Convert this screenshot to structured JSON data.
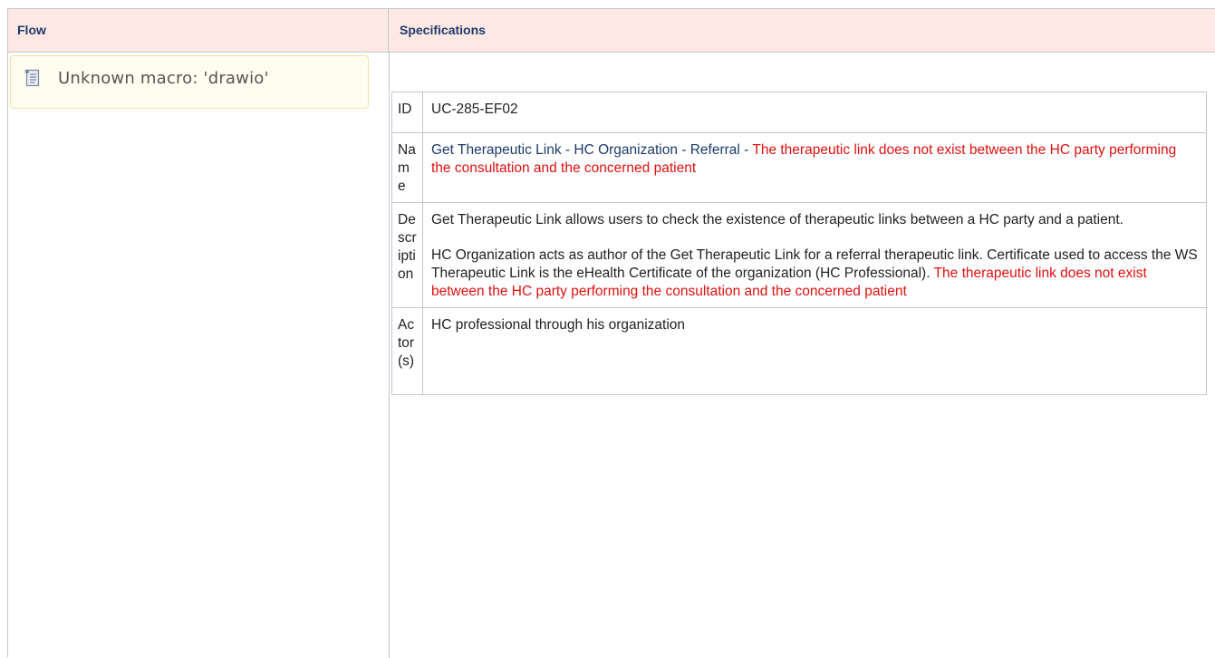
{
  "headers": {
    "flow": "Flow",
    "specifications": "Specifications"
  },
  "macro": {
    "icon": "document-icon",
    "text": "Unknown macro: 'drawio'"
  },
  "spec_rows": {
    "id": {
      "label": "ID",
      "value": "UC-285-EF02"
    },
    "name": {
      "label": "Name",
      "value_main": "Get Therapeutic Link -  HC Organization - Referral - ",
      "value_exception": "The therapeutic link does not exist between the HC party performing the consultation and the concerned patient"
    },
    "description": {
      "label": "Description",
      "paragraph1": "Get Therapeutic Link allows users to check the existence of therapeutic links between a HC party and a patient.",
      "paragraph2_main": "HC Organization acts as author of the Get Therapeutic Link for a referral therapeutic link. Certificate used to access the WS Therapeutic Link is the eHealth Certificate of the organization (HC Professional). ",
      "paragraph2_exception": "The therapeutic link does not exist between the HC party performing the consultation and the concerned patient"
    },
    "actors": {
      "label": "Actor(s)",
      "value": "HC professional through his organization"
    }
  },
  "colors": {
    "header_bg": "#fde8e4",
    "header_text": "#1d3a6b",
    "exception_text": "#e01010",
    "border": "#c1c7d0"
  }
}
